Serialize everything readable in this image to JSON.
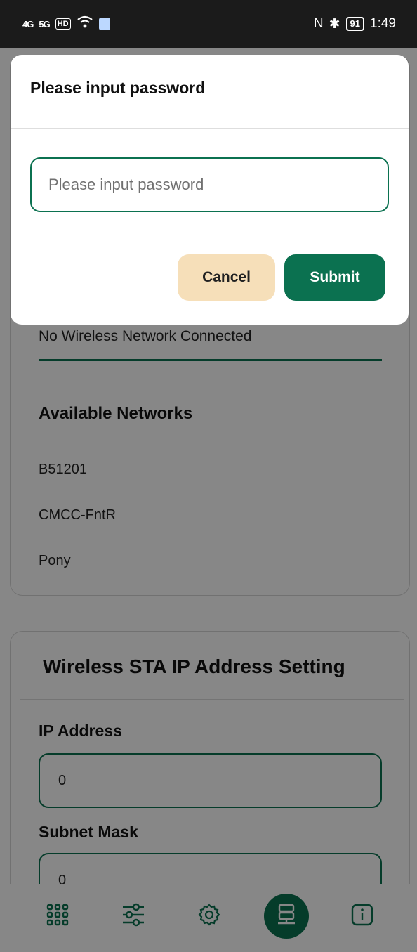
{
  "status_bar": {
    "signal1": "4G",
    "signal2": "5G",
    "hd": "HD",
    "nfc": "N",
    "bluetooth": "✱",
    "battery": "91",
    "time": "1:49"
  },
  "dialog": {
    "title": "Please input password",
    "password_placeholder": "Please input password",
    "password_value": "",
    "cancel_label": "Cancel",
    "submit_label": "Submit"
  },
  "wifi": {
    "connection_status": "No Wireless Network Connected",
    "available_title": "Available Networks",
    "networks": [
      "B51201",
      "CMCC-FntR",
      "Pony"
    ]
  },
  "ip_settings": {
    "title": "Wireless STA IP Address Setting",
    "ip_label": "IP Address",
    "ip_value": "0",
    "subnet_label": "Subnet Mask",
    "subnet_value": "0"
  },
  "bottom_nav": {
    "items": [
      {
        "icon": "grid-icon",
        "active": false
      },
      {
        "icon": "sliders-icon",
        "active": false
      },
      {
        "icon": "gear-icon",
        "active": false
      },
      {
        "icon": "network-icon",
        "active": true
      },
      {
        "icon": "info-icon",
        "active": false
      }
    ]
  },
  "colors": {
    "accent": "#0b7150",
    "cancel_bg": "#f6dfb9",
    "status_bar_bg": "#1b1b1b"
  }
}
